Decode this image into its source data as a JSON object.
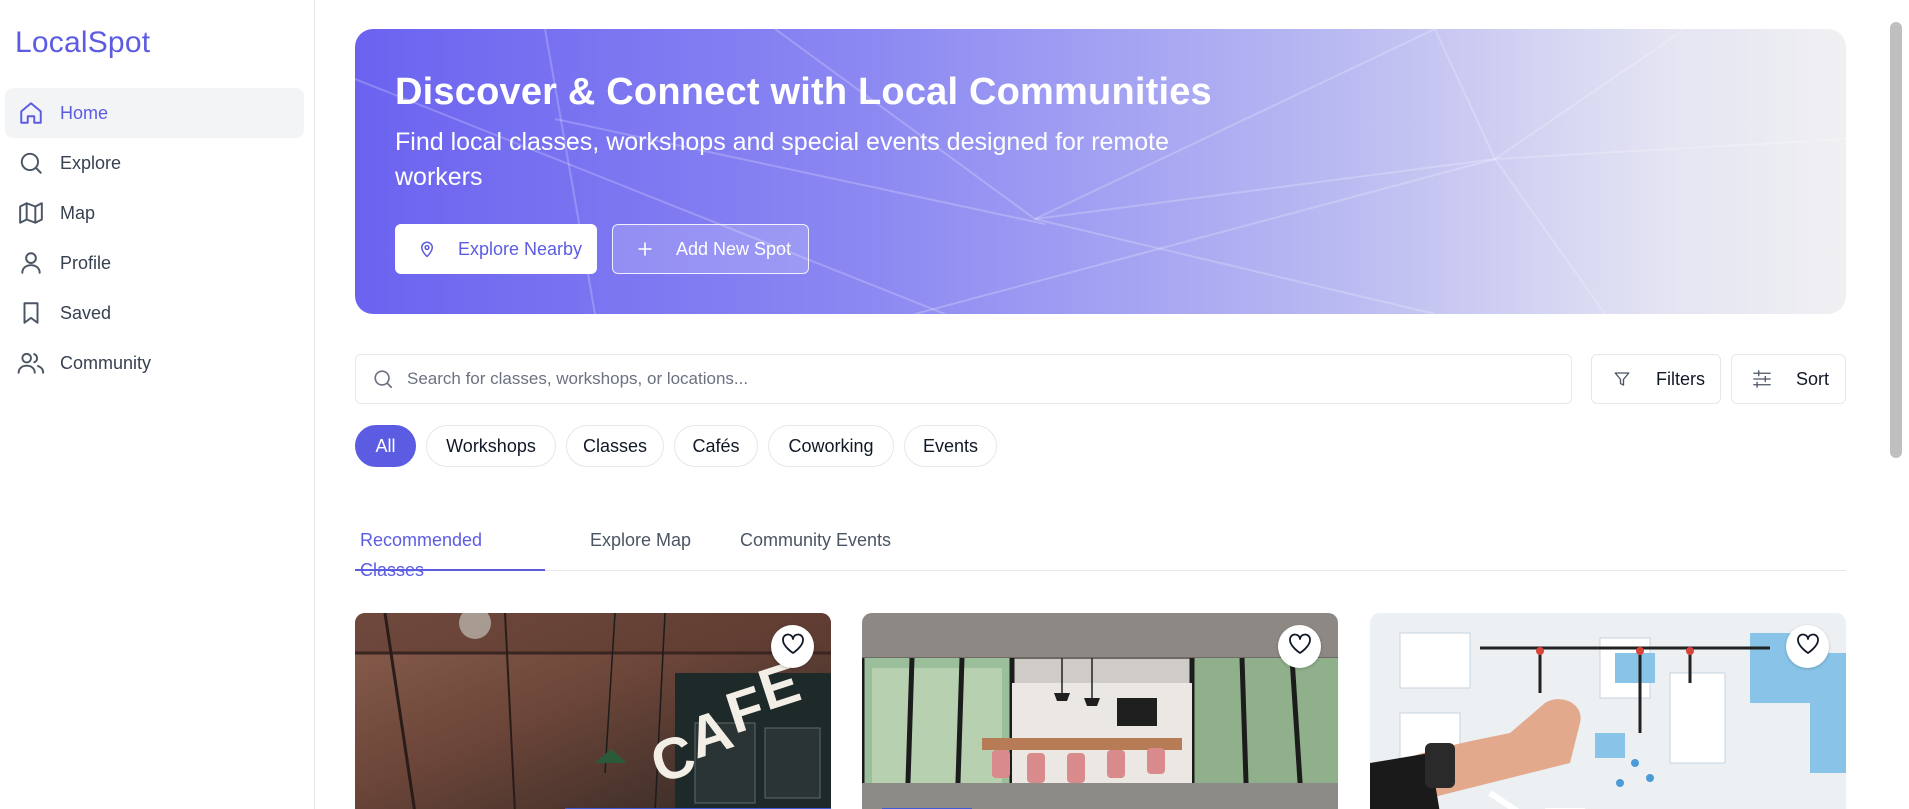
{
  "app": {
    "brand": "LocalSpot"
  },
  "sidebar": {
    "items": [
      {
        "label": "Home",
        "icon": "home-icon",
        "active": true
      },
      {
        "label": "Explore",
        "icon": "search-icon",
        "active": false
      },
      {
        "label": "Map",
        "icon": "map-icon",
        "active": false
      },
      {
        "label": "Profile",
        "icon": "user-icon",
        "active": false
      },
      {
        "label": "Saved",
        "icon": "bookmark-icon",
        "active": false
      },
      {
        "label": "Community",
        "icon": "users-icon",
        "active": false
      }
    ]
  },
  "hero": {
    "title": "Discover & Connect with Local Communities",
    "subtitle": "Find local classes, workshops and special events designed for remote workers",
    "primary_button": "Explore Nearby",
    "secondary_button": "Add New Spot"
  },
  "search": {
    "placeholder": "Search for classes, workshops, or locations..."
  },
  "toolbar": {
    "filters_label": "Filters",
    "sort_label": "Sort"
  },
  "chips": [
    {
      "label": "All",
      "active": true
    },
    {
      "label": "Workshops",
      "active": false
    },
    {
      "label": "Classes",
      "active": false
    },
    {
      "label": "Cafés",
      "active": false
    },
    {
      "label": "Coworking",
      "active": false
    },
    {
      "label": "Events",
      "active": false
    }
  ],
  "tabs": [
    {
      "label": "Recommended Classes",
      "active": true
    },
    {
      "label": "Explore Map",
      "active": false
    },
    {
      "label": "Community Events",
      "active": false
    }
  ],
  "cards": [
    {
      "image": "cafe-photo",
      "sign": "CAFE",
      "favorite_icon": "heart-icon"
    },
    {
      "image": "coworking-room-photo",
      "favorite_icon": "heart-icon"
    },
    {
      "image": "whiteboard-planning-photo",
      "favorite_icon": "heart-icon"
    }
  ],
  "colors": {
    "accent": "#5b5ce2",
    "border": "#e5e7eb",
    "text": "#111827",
    "muted": "#4b5563"
  }
}
